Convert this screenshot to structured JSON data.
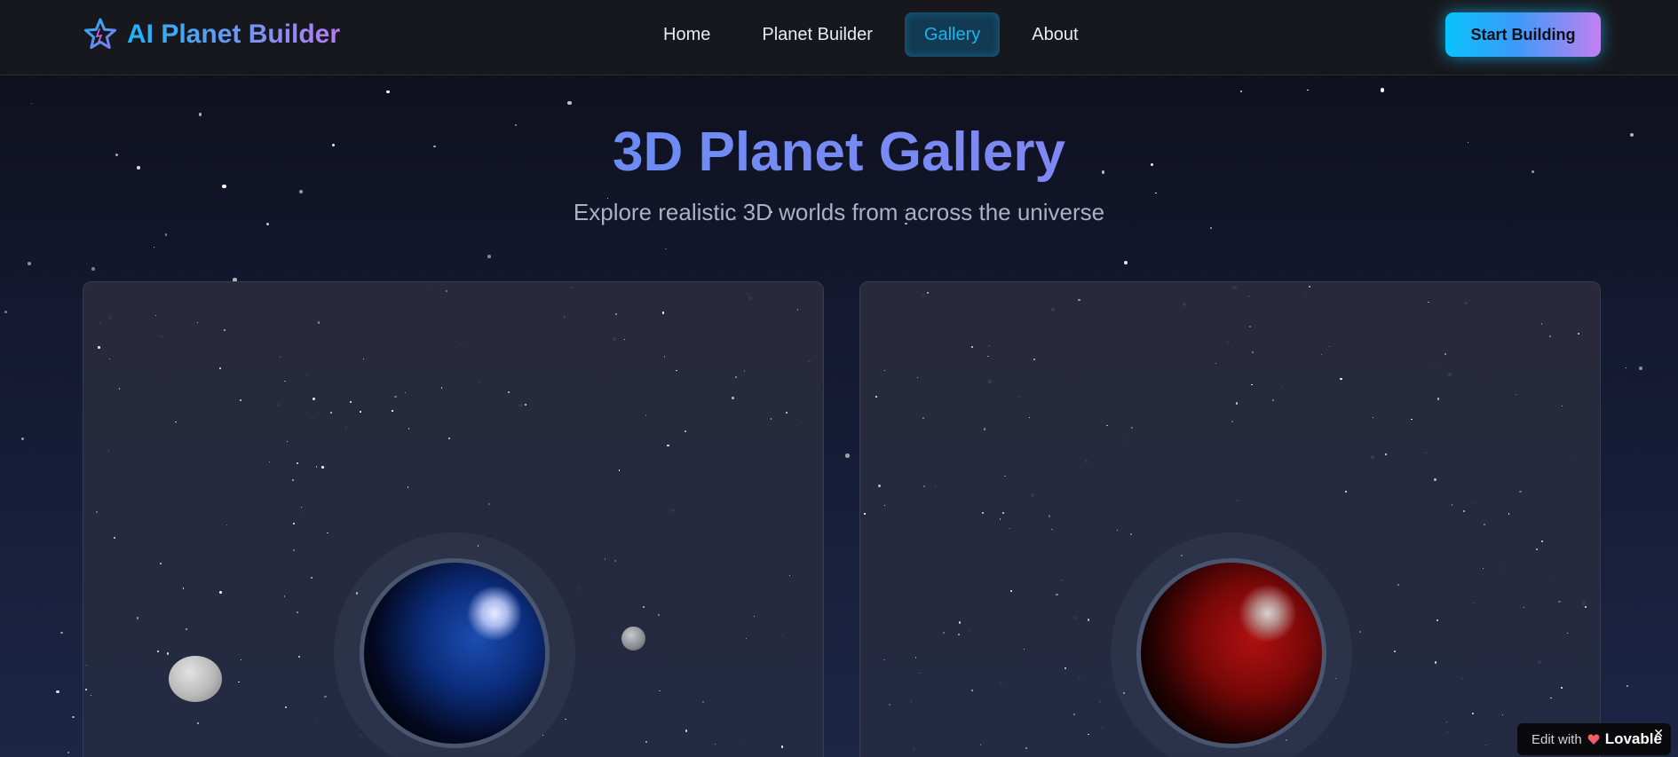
{
  "header": {
    "brand": "AI Planet Builder",
    "nav": [
      {
        "label": "Home",
        "active": false
      },
      {
        "label": "Planet Builder",
        "active": false
      },
      {
        "label": "Gallery",
        "active": true
      },
      {
        "label": "About",
        "active": false
      }
    ],
    "cta_label": "Start Building"
  },
  "hero": {
    "title": "3D Planet Gallery",
    "subtitle": "Explore realistic 3D worlds from across the universe"
  },
  "gallery": {
    "cards": [
      {
        "planet_color": "blue",
        "moons": 2
      },
      {
        "planet_color": "red",
        "moons": 0
      }
    ]
  },
  "badge": {
    "label": "Edit with",
    "brand": "Lovable",
    "close": "✕"
  },
  "colors": {
    "accent_cyan": "#17b5f2",
    "accent_purple": "#b67cf2",
    "header_bg": "#17181d",
    "page_bg_top": "#0d0e17",
    "page_bg_bottom": "#1c2645"
  },
  "icons": {
    "brand": "star-sparkle-icon",
    "badge": "heart-icon",
    "close": "close-icon"
  }
}
